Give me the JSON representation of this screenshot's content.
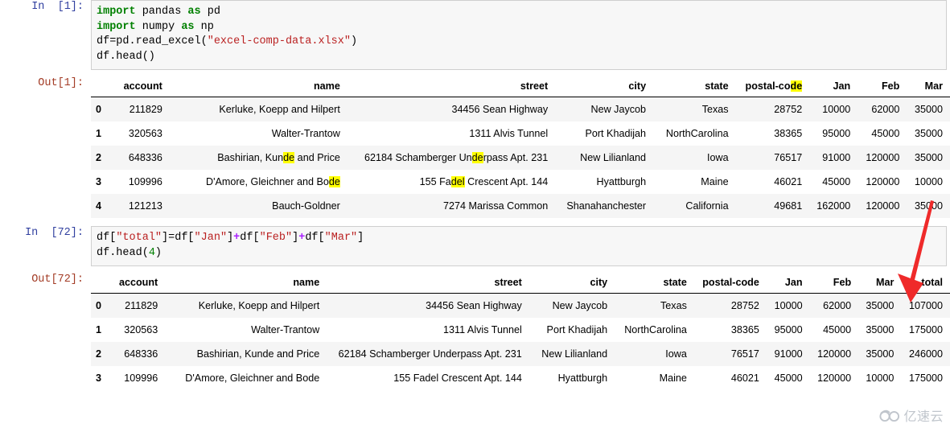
{
  "notebook": {
    "highlight_term": "de",
    "highlight_color": "#ffff00",
    "annotation": {
      "arrow_name": "red-down-left-arrow",
      "arrow_color": "#ef2a2a"
    },
    "watermark": {
      "text": "亿速云",
      "logo_icon": "cloud-glasses-logo-icon"
    }
  },
  "cells": [
    {
      "in_prompt": "In  [1]:",
      "out_prompt": "Out[1]:",
      "code_lines": [
        [
          {
            "t": "import",
            "c": "kw"
          },
          {
            "t": " pandas ",
            "c": ""
          },
          {
            "t": "as",
            "c": "kw"
          },
          {
            "t": " pd",
            "c": ""
          }
        ],
        [
          {
            "t": "import",
            "c": "kw"
          },
          {
            "t": " numpy ",
            "c": ""
          },
          {
            "t": "as",
            "c": "kw"
          },
          {
            "t": " np",
            "c": ""
          }
        ],
        [
          {
            "t": "df=pd.read_excel(",
            "c": ""
          },
          {
            "t": "\"excel-comp-data.xlsx\"",
            "c": "str"
          },
          {
            "t": ")",
            "c": ""
          }
        ],
        [
          {
            "t": "df.head()",
            "c": ""
          }
        ]
      ],
      "code_text": "import pandas as pd\nimport numpy as np\ndf=pd.read_excel(\"excel-comp-data.xlsx\")\ndf.head()"
    },
    {
      "in_prompt": "In  [72]:",
      "out_prompt": "Out[72]:",
      "code_lines": [
        [
          {
            "t": "df[",
            "c": ""
          },
          {
            "t": "\"total\"",
            "c": "str"
          },
          {
            "t": "]=df[",
            "c": ""
          },
          {
            "t": "\"Jan\"",
            "c": "str"
          },
          {
            "t": "]",
            "c": ""
          },
          {
            "t": "+",
            "c": "op"
          },
          {
            "t": "df[",
            "c": ""
          },
          {
            "t": "\"Feb\"",
            "c": "str"
          },
          {
            "t": "]",
            "c": ""
          },
          {
            "t": "+",
            "c": "op"
          },
          {
            "t": "df[",
            "c": ""
          },
          {
            "t": "\"Mar\"",
            "c": "str"
          },
          {
            "t": "]",
            "c": ""
          }
        ],
        [
          {
            "t": "df.head(",
            "c": ""
          },
          {
            "t": "4",
            "c": "num"
          },
          {
            "t": ")",
            "c": ""
          }
        ]
      ],
      "code_text": "df[\"total\"]=df[\"Jan\"]+df[\"Feb\"]+df[\"Mar\"]\ndf.head(4)"
    }
  ],
  "table_one": {
    "columns": [
      "account",
      "name",
      "street",
      "city",
      "state",
      "postal-code",
      "Jan",
      "Feb",
      "Mar"
    ],
    "column_highlight": {
      "postal-code": [
        "postal-co",
        "de",
        ""
      ]
    },
    "index": [
      "0",
      "1",
      "2",
      "3",
      "4"
    ],
    "rows": [
      {
        "index": "0",
        "account": "211829",
        "name": "Kerluke, Koepp and Hilpert",
        "street": "34456 Sean Highway",
        "city": "New Jaycob",
        "state": "Texas",
        "postal_code": "28752",
        "Jan": "10000",
        "Feb": "62000",
        "Mar": "35000"
      },
      {
        "index": "1",
        "account": "320563",
        "name": "Walter-Trantow",
        "street": "1311 Alvis Tunnel",
        "city": "Port Khadijah",
        "state": "NorthCarolina",
        "postal_code": "38365",
        "Jan": "95000",
        "Feb": "45000",
        "Mar": "35000"
      },
      {
        "index": "2",
        "account": "648336",
        "name": "Bashirian, Kunde and Price",
        "name_parts": [
          "Bashirian, Kun",
          "de",
          " and Price"
        ],
        "street": "62184 Schamberger Underpass Apt. 231",
        "street_parts": [
          "62184 Schamberger Un",
          "de",
          "rpass Apt. 231"
        ],
        "city": "New Lilianland",
        "state": "Iowa",
        "postal_code": "76517",
        "Jan": "91000",
        "Feb": "120000",
        "Mar": "35000"
      },
      {
        "index": "3",
        "account": "109996",
        "name": "D'Amore, Gleichner and Bode",
        "name_parts": [
          "D'Amore, Gleichner and Bo",
          "de",
          ""
        ],
        "street": "155 Fadel Crescent Apt. 144",
        "street_parts": [
          "155 Fa",
          "del",
          " Crescent Apt. 144"
        ],
        "city": "Hyattburgh",
        "state": "Maine",
        "postal_code": "46021",
        "Jan": "45000",
        "Feb": "120000",
        "Mar": "10000"
      },
      {
        "index": "4",
        "account": "121213",
        "name": "Bauch-Goldner",
        "street": "7274 Marissa Common",
        "city": "Shanahanchester",
        "state": "California",
        "postal_code": "49681",
        "Jan": "162000",
        "Feb": "120000",
        "Mar": "35000"
      }
    ]
  },
  "table_two": {
    "columns": [
      "account",
      "name",
      "street",
      "city",
      "state",
      "postal-code",
      "Jan",
      "Feb",
      "Mar",
      "total"
    ],
    "index": [
      "0",
      "1",
      "2",
      "3"
    ],
    "rows": [
      {
        "index": "0",
        "account": "211829",
        "name": "Kerluke, Koepp and Hilpert",
        "street": "34456 Sean Highway",
        "city": "New Jaycob",
        "state": "Texas",
        "postal_code": "28752",
        "Jan": "10000",
        "Feb": "62000",
        "Mar": "35000",
        "total": "107000"
      },
      {
        "index": "1",
        "account": "320563",
        "name": "Walter-Trantow",
        "street": "1311 Alvis Tunnel",
        "city": "Port Khadijah",
        "state": "NorthCarolina",
        "postal_code": "38365",
        "Jan": "95000",
        "Feb": "45000",
        "Mar": "35000",
        "total": "175000"
      },
      {
        "index": "2",
        "account": "648336",
        "name": "Bashirian, Kunde and Price",
        "street": "62184 Schamberger Underpass Apt. 231",
        "city": "New Lilianland",
        "state": "Iowa",
        "postal_code": "76517",
        "Jan": "91000",
        "Feb": "120000",
        "Mar": "35000",
        "total": "246000"
      },
      {
        "index": "3",
        "account": "109996",
        "name": "D'Amore, Gleichner and Bode",
        "street": "155 Fadel Crescent Apt. 144",
        "city": "Hyattburgh",
        "state": "Maine",
        "postal_code": "46021",
        "Jan": "45000",
        "Feb": "120000",
        "Mar": "10000",
        "total": "175000"
      }
    ]
  }
}
